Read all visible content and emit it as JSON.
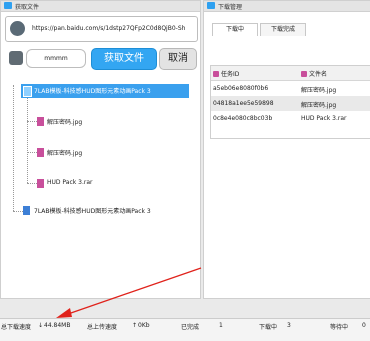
{
  "left_panel": {
    "title": "获取文件",
    "url": "https://pan.baidu.com/s/1dstp27QFp2C0d8QjB0-Sh",
    "code": "mmmm",
    "get_button": "获取文件",
    "cancel_button": "取消",
    "tree": [
      {
        "label": "7LAB模板-科技感HUD图形元素动画Pack 3",
        "selected": true
      },
      {
        "label": "解压密码.jpg"
      },
      {
        "label": "解压密码.jpg"
      },
      {
        "label": "HUD Pack 3.rar"
      },
      {
        "label": "7LAB模板-科技感HUD图形元素动画Pack 3"
      }
    ]
  },
  "right_panel": {
    "title": "下载管理",
    "tabs": [
      "下载中",
      "下载完成"
    ],
    "columns": [
      "任务ID",
      "文件名"
    ],
    "rows": [
      {
        "id": "a5eb06e8080f0b6",
        "name": "解压密码.jpg"
      },
      {
        "id": "04818a1ee5e59898",
        "name": "解压密码.jpg"
      },
      {
        "id": "0c8e4e080c8bc03b",
        "name": "HUD Pack 3.rar"
      }
    ]
  },
  "status_bar": {
    "download_speed_label": "总下载速度",
    "download_speed_value": "44.84MB",
    "upload_speed_label": "总上传速度",
    "upload_speed_value": "0Kb",
    "completed_label": "已完成",
    "completed_value": "1",
    "downloading_label": "下载中",
    "downloading_value": "3",
    "waiting_label": "等待中",
    "waiting_value": "0"
  },
  "colors": {
    "accent": "#33a6f2",
    "selection": "#3aa0ee",
    "file_icon": "#c84f9b",
    "arrow": "#e0221b"
  }
}
